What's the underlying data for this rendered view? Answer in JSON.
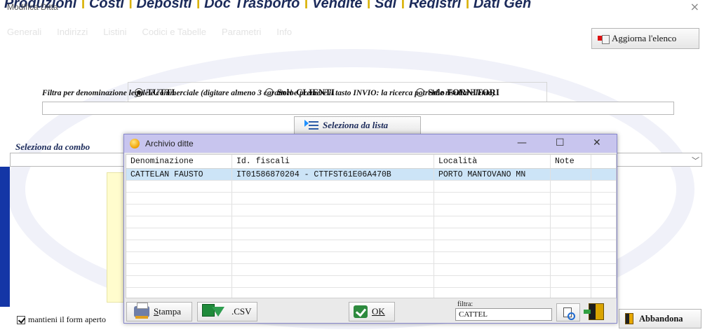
{
  "top_menu": {
    "items": [
      "Produzioni",
      "Costi",
      "Depositi",
      "Doc Trasporto",
      "Vendite",
      "Sdi",
      "Registri",
      "Dati Gen"
    ]
  },
  "dialog": {
    "title": "Modifica Ditta",
    "close_glyph": "×",
    "tabs": [
      "Generali",
      "Indirizzi",
      "Listini",
      "Codici e Tabelle",
      "Parametri",
      "Info"
    ],
    "refresh_button": "Aggiorna l'elenco",
    "radios": {
      "all": "TUTTI",
      "clients": "Solo CLIENTI",
      "suppliers": "Solo FORNITORI",
      "selected": "all"
    },
    "filter_caption": "Filtra per denominazione legale e commerciale (digitare almeno 3 caratteri e premere il tasto INVIO: la ricerca potrebbe risultare lenta)",
    "search_value": "",
    "select_list_button": "Seleziona da lista",
    "combo_caption": "Seleziona da combo",
    "combo_value": "",
    "combo_arrow": "﹀",
    "keep_open_label": "mantieni il form aperto",
    "cancel_button": "Abbandona"
  },
  "archive_window": {
    "title": "Archivio ditte",
    "controls": {
      "minimize": "—",
      "maximize": "☐",
      "close": "✕"
    },
    "columns": [
      "Denominazione",
      "Id. fiscali",
      "Località",
      "Note",
      ""
    ],
    "rows": [
      [
        "CATTELAN FAUSTO",
        "IT01586870204 - CTTFST61E06A470B",
        "PORTO MANTOVANO MN",
        "",
        ""
      ]
    ],
    "empty_rows": 11,
    "footer": {
      "print_button": "Stampa",
      "csv_button": ".CSV",
      "ok_button": "OK",
      "filter_label": "filtra:",
      "filter_value": "CATTEL"
    }
  },
  "colors": {
    "title_bar": "#c8c5ee",
    "selected_row": "#cce4f7",
    "menu_text": "#1b2a5a",
    "left_accent": "#1436a6"
  }
}
